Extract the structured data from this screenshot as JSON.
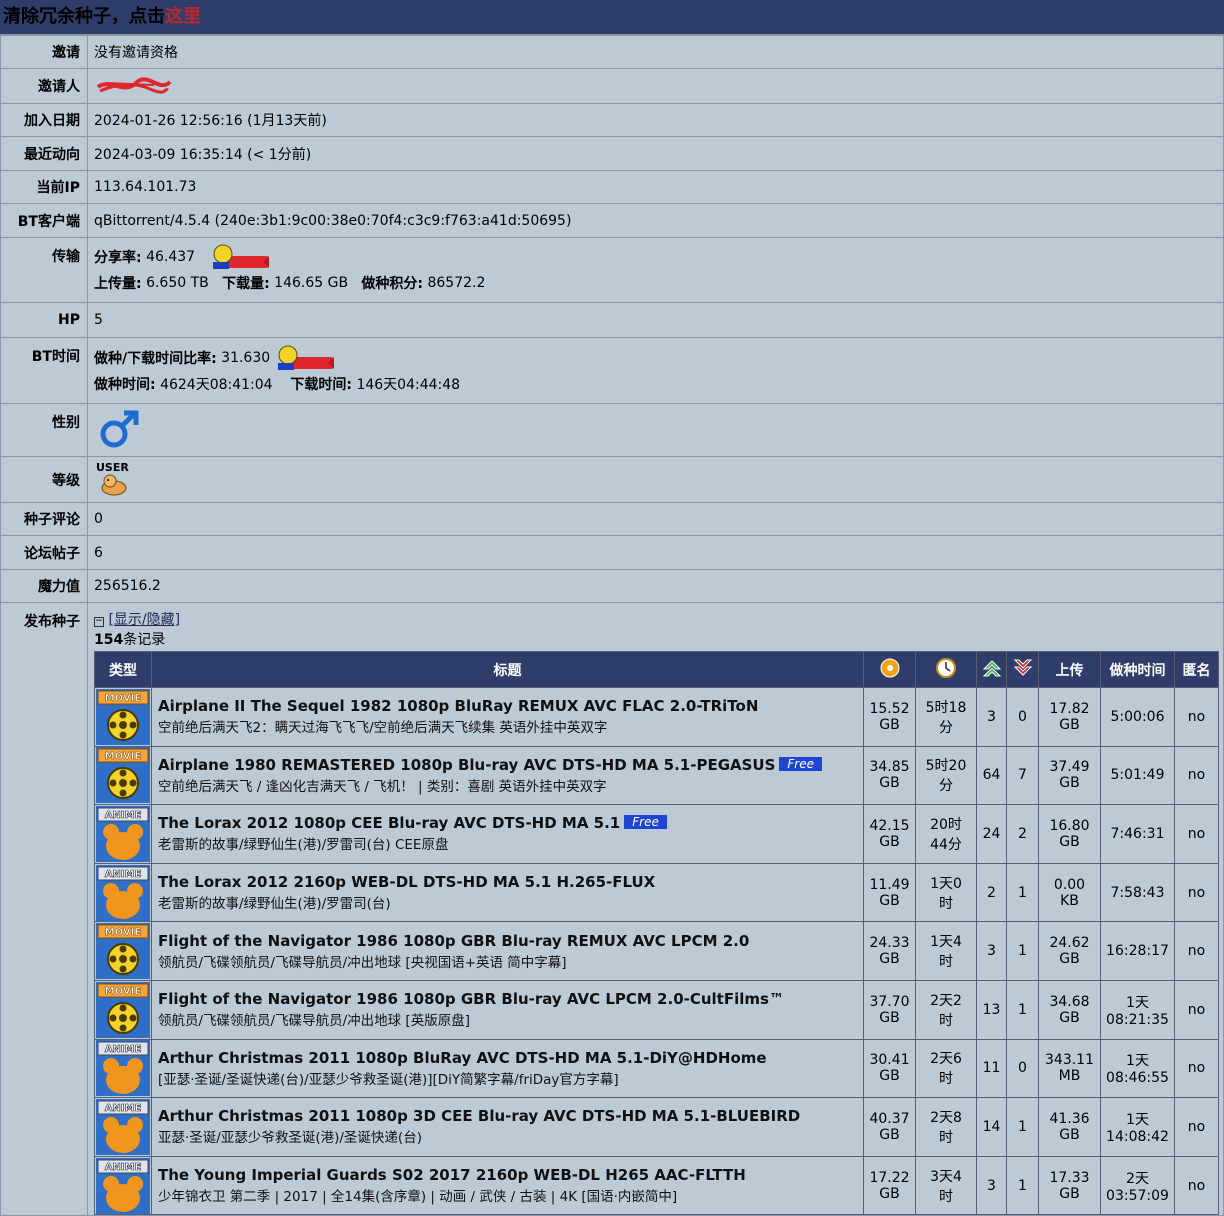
{
  "banner": {
    "text": "清除冗余种子，点击",
    "link": "这里"
  },
  "profile": [
    {
      "key": "invite",
      "label": "邀请",
      "value": "没有邀请资格"
    },
    {
      "key": "inviter",
      "label": "邀请人",
      "value": ""
    },
    {
      "key": "join_date",
      "label": "加入日期",
      "value": "2024-01-26 12:56:16 (1月13天前)"
    },
    {
      "key": "last_active",
      "label": "最近动向",
      "value": "2024-03-09 16:35:14 (< 1分前)"
    },
    {
      "key": "current_ip",
      "label": "当前IP",
      "value": "113.64.101.73"
    },
    {
      "key": "bt_client",
      "label": "BT客户端",
      "value": "qBittorrent/4.5.4 (240e:3b1:9c00:38e0:70f4:c3c9:f763:a41d:50695)"
    }
  ],
  "transfer": {
    "label": "传输",
    "ratio_label": "分享率:",
    "ratio": "46.437",
    "upload_label": "上传量:",
    "upload": "6.650 TB",
    "download_label": "下载量:",
    "download": "146.65 GB",
    "seed_points_label": "做种积分:",
    "seed_points": "86572.2"
  },
  "hp": {
    "label": "HP",
    "value": "5"
  },
  "bt_time": {
    "label": "BT时间",
    "ratio_label": "做种/下载时间比率:",
    "ratio": "31.630",
    "seed_label": "做种时间:",
    "seed": "4624天08:41:04",
    "dl_label": "下载时间:",
    "dl": "146天04:44:48"
  },
  "gender": {
    "label": "性别",
    "icon": "male-icon",
    "color": "#1f6bd1"
  },
  "level": {
    "label": "等级",
    "class": "USER"
  },
  "comments": {
    "label": "种子评论",
    "value": "0"
  },
  "forum_posts": {
    "label": "论坛帖子",
    "value": "6"
  },
  "magic": {
    "label": "魔力值",
    "value": "256516.2"
  },
  "uploads": {
    "label": "发布种子",
    "toggle": "[显示/隐藏]",
    "count": "154",
    "count_suffix": "条记录",
    "headers": {
      "type": "类型",
      "title": "标题",
      "seed_time": "做种时间",
      "upload": "上传",
      "anon": "匿名"
    },
    "rows": [
      {
        "cat": "MOVIE",
        "title": "Airplane II The Sequel 1982 1080p BluRay REMUX AVC FLAC 2.0-TRiToN",
        "free": "",
        "subtitle": "空前绝后满天飞2：瞒天过海飞飞飞/空前绝后满天飞续集 英语外挂中英双字",
        "size": [
          "15.52",
          "GB"
        ],
        "time": [
          "5时18",
          "分"
        ],
        "seeders": "3",
        "leechers": "0",
        "uploaded": [
          "17.82",
          "GB"
        ],
        "seedtime": [
          "5:00:06",
          ""
        ],
        "anon": "no"
      },
      {
        "cat": "MOVIE",
        "title": "Airplane 1980 REMASTERED 1080p Blu-ray AVC DTS-HD MA 5.1-PEGASUS",
        "free": "Free",
        "subtitle": "空前绝后满天飞 / 逢凶化吉满天飞 / 飞机！ | 类别：喜剧 英语外挂中英双字",
        "size": [
          "34.85",
          "GB"
        ],
        "time": [
          "5时20",
          "分"
        ],
        "seeders": "64",
        "leechers": "7",
        "uploaded": [
          "37.49",
          "GB"
        ],
        "seedtime": [
          "5:01:49",
          ""
        ],
        "anon": "no"
      },
      {
        "cat": "ANIME",
        "title": "The Lorax 2012 1080p CEE Blu-ray AVC DTS-HD MA 5.1",
        "free": "Free",
        "subtitle": "老雷斯的故事/绿野仙生(港)/罗雷司(台) CEE原盘",
        "size": [
          "42.15",
          "GB"
        ],
        "time": [
          "20时",
          "44分"
        ],
        "seeders": "24",
        "leechers": "2",
        "uploaded": [
          "16.80",
          "GB"
        ],
        "seedtime": [
          "7:46:31",
          ""
        ],
        "anon": "no"
      },
      {
        "cat": "ANIME",
        "title": "The Lorax 2012 2160p WEB-DL DTS-HD MA 5.1 H.265-FLUX",
        "free": "",
        "subtitle": "老雷斯的故事/绿野仙生(港)/罗雷司(台)",
        "size": [
          "11.49",
          "GB"
        ],
        "time": [
          "1天0",
          "时"
        ],
        "seeders": "2",
        "leechers": "1",
        "uploaded": [
          "0.00",
          "KB"
        ],
        "seedtime": [
          "7:58:43",
          ""
        ],
        "anon": "no"
      },
      {
        "cat": "MOVIE",
        "title": "Flight of the Navigator 1986 1080p GBR Blu-ray REMUX AVC LPCM 2.0",
        "free": "",
        "subtitle": "领航员/飞碟领航员/飞碟导航员/冲出地球 [央视国语+英语 简中字幕]",
        "size": [
          "24.33",
          "GB"
        ],
        "time": [
          "1天4",
          "时"
        ],
        "seeders": "3",
        "leechers": "1",
        "uploaded": [
          "24.62",
          "GB"
        ],
        "seedtime": [
          "16:28:17",
          ""
        ],
        "anon": "no"
      },
      {
        "cat": "MOVIE",
        "title": "Flight of the Navigator 1986 1080p GBR Blu-ray AVC LPCM 2.0-CultFilms™",
        "free": "",
        "subtitle": "领航员/飞碟领航员/飞碟导航员/冲出地球 [英版原盘]",
        "size": [
          "37.70",
          "GB"
        ],
        "time": [
          "2天2",
          "时"
        ],
        "seeders": "13",
        "leechers": "1",
        "uploaded": [
          "34.68",
          "GB"
        ],
        "seedtime": [
          "1天",
          "08:21:35"
        ],
        "anon": "no"
      },
      {
        "cat": "ANIME",
        "title": "Arthur Christmas 2011 1080p BluRay AVC DTS-HD MA 5.1-DiY@HDHome",
        "free": "",
        "subtitle": "[亚瑟·圣诞/圣诞快递(台)/亚瑟少爷救圣诞(港)][DiY简繁字幕/friDay官方字幕]",
        "size": [
          "30.41",
          "GB"
        ],
        "time": [
          "2天6",
          "时"
        ],
        "seeders": "11",
        "leechers": "0",
        "uploaded": [
          "343.11",
          "MB"
        ],
        "seedtime": [
          "1天",
          "08:46:55"
        ],
        "anon": "no"
      },
      {
        "cat": "ANIME",
        "title": "Arthur Christmas 2011 1080p 3D CEE Blu-ray AVC DTS-HD MA 5.1-BLUEBIRD",
        "free": "",
        "subtitle": "亚瑟·圣诞/亚瑟少爷救圣诞(港)/圣诞快递(台)",
        "size": [
          "40.37",
          "GB"
        ],
        "time": [
          "2天8",
          "时"
        ],
        "seeders": "14",
        "leechers": "1",
        "uploaded": [
          "41.36",
          "GB"
        ],
        "seedtime": [
          "1天",
          "14:08:42"
        ],
        "anon": "no"
      },
      {
        "cat": "ANIME",
        "title": "The Young Imperial Guards S02 2017 2160p WEB-DL H265 AAC-FLTTH",
        "free": "",
        "subtitle": "少年锦衣卫 第二季 | 2017 | 全14集(含序章) | 动画 / 武侠 / 古装 | 4K [国语·内嵌简中]",
        "size": [
          "17.22",
          "GB"
        ],
        "time": [
          "3天4",
          "时"
        ],
        "seeders": "3",
        "leechers": "1",
        "uploaded": [
          "17.33",
          "GB"
        ],
        "seedtime": [
          "2天",
          "03:57:09"
        ],
        "anon": "no"
      }
    ]
  }
}
